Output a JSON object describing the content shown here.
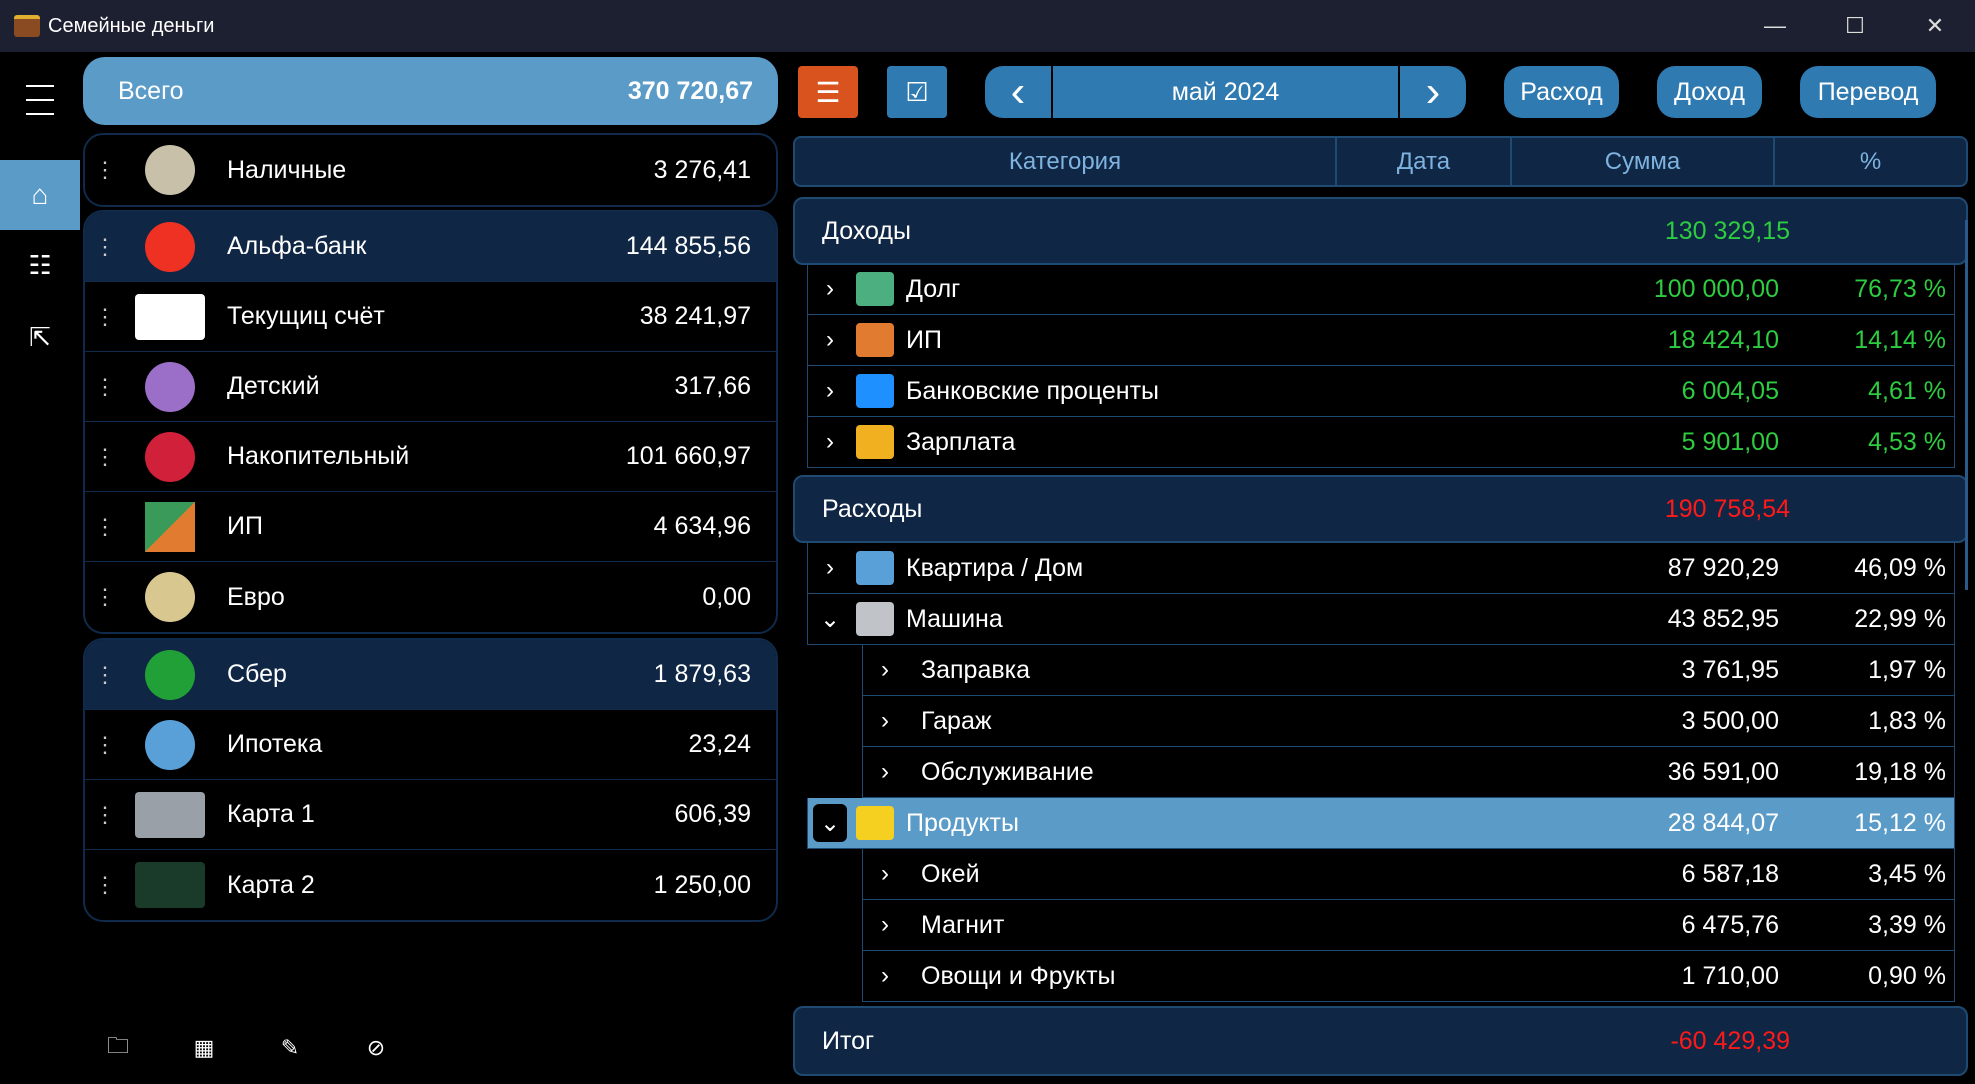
{
  "window": {
    "title": "Семейные деньги",
    "min": "—",
    "max": "☐",
    "close": "✕"
  },
  "total": {
    "label": "Всего",
    "value": "370 720,67"
  },
  "groups": [
    [
      {
        "name": "Наличные",
        "amount": "3 276,41",
        "icon": "coins-icon",
        "color": "#c8c0a8"
      }
    ],
    [
      {
        "name": "Альфа-банк",
        "amount": "144 855,56",
        "icon": "alfa-bank-icon",
        "color": "#ef3124",
        "header": true
      },
      {
        "name": "Текущиц счёт",
        "amount": "38 241,97",
        "icon": "card-icon",
        "color": "#ffffff"
      },
      {
        "name": "Детский",
        "amount": "317,66",
        "icon": "pony-icon",
        "color": "#9b6fc8"
      },
      {
        "name": "Накопительный",
        "amount": "101 660,97",
        "icon": "piggy-bank-icon",
        "color": "#d0203a"
      },
      {
        "name": "ИП",
        "amount": "4 634,96",
        "icon": "ip-icon",
        "color": "#e07b30"
      },
      {
        "name": "Евро",
        "amount": "0,00",
        "icon": "euro-coin-icon",
        "color": "#d8c890"
      }
    ],
    [
      {
        "name": "Сбер",
        "amount": "1 879,63",
        "icon": "sber-icon",
        "color": "#21a038",
        "header": true
      },
      {
        "name": "Ипотека",
        "amount": "23,24",
        "icon": "house-icon",
        "color": "#5aa0d8"
      },
      {
        "name": "Карта 1",
        "amount": "606,39",
        "icon": "card-icon",
        "color": "#9aa0a8"
      },
      {
        "name": "Карта 2",
        "amount": "1 250,00",
        "icon": "card-icon",
        "color": "#1a3a2a"
      }
    ]
  ],
  "toolbar": {
    "month": "май 2024",
    "prev": "‹",
    "next": "›",
    "expense": "Расход",
    "income": "Доход",
    "transfer": "Перевод"
  },
  "table": {
    "headers": [
      "Категория",
      "Дата",
      "Сумма",
      "%"
    ]
  },
  "income": {
    "label": "Доходы",
    "total": "130 329,15",
    "color": "#2ecc40",
    "rows": [
      {
        "name": "Долг",
        "amount": "100 000,00",
        "pct": "76,73 %",
        "icon": "debt-icon",
        "color": "#4caf80"
      },
      {
        "name": "ИП",
        "amount": "18 424,10",
        "pct": "14,14 %",
        "icon": "ip-icon",
        "color": "#e07b30"
      },
      {
        "name": "Банковские проценты",
        "amount": "6 004,05",
        "pct": "4,61 %",
        "icon": "percent-icon",
        "color": "#1e90ff"
      },
      {
        "name": "Зарплата",
        "amount": "5 901,00",
        "pct": "4,53 %",
        "icon": "coins-icon",
        "color": "#f0b020"
      }
    ]
  },
  "expense": {
    "label": "Расходы",
    "total": "190 758,54",
    "color": "#ff1a1a",
    "rows": [
      {
        "name": "Квартира / Дом",
        "amount": "87 920,29",
        "pct": "46,09 %",
        "icon": "house-icon",
        "color": "#5aa0d8",
        "level": 0,
        "chev": "›"
      },
      {
        "name": "Машина",
        "amount": "43 852,95",
        "pct": "22,99 %",
        "icon": "car-icon",
        "color": "#c0c4c8",
        "level": 0,
        "chev": "⌄"
      },
      {
        "name": "Заправка",
        "amount": "3 761,95",
        "pct": "1,97 %",
        "level": 1,
        "chev": "›"
      },
      {
        "name": "Гараж",
        "amount": "3 500,00",
        "pct": "1,83 %",
        "level": 1,
        "chev": "›"
      },
      {
        "name": "Обслуживание",
        "amount": "36 591,00",
        "pct": "19,18 %",
        "level": 1,
        "chev": "›"
      },
      {
        "name": "Продукты",
        "amount": "28 844,07",
        "pct": "15,12 %",
        "icon": "banana-icon",
        "color": "#f5d020",
        "level": 0,
        "chev": "⌄",
        "selected": true
      },
      {
        "name": "Окей",
        "amount": "6 587,18",
        "pct": "3,45 %",
        "level": 1,
        "chev": "›"
      },
      {
        "name": "Магнит",
        "amount": "6 475,76",
        "pct": "3,39 %",
        "level": 1,
        "chev": "›"
      },
      {
        "name": "Овощи и Фрукты",
        "amount": "1 710,00",
        "pct": "0,90 %",
        "level": 1,
        "chev": "›"
      }
    ]
  },
  "summary": {
    "label": "Итог",
    "total": "-60 429,39"
  }
}
